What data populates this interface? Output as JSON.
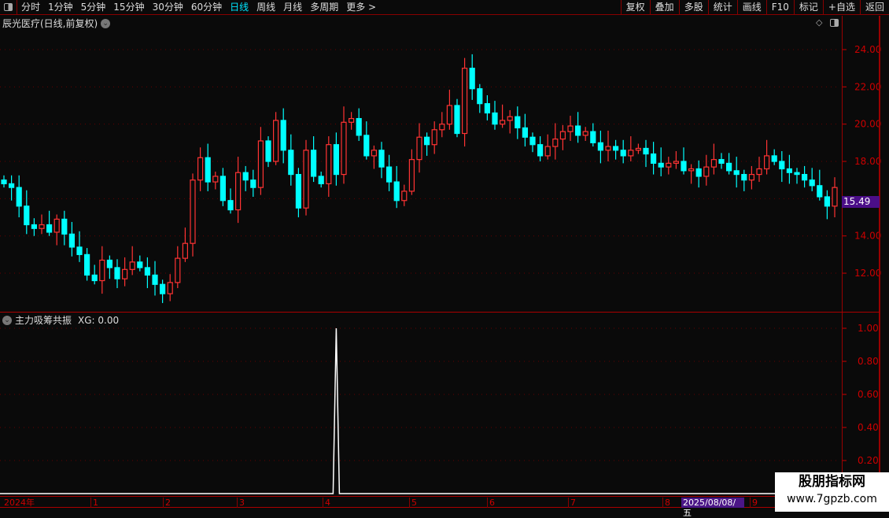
{
  "toolbar": {
    "periods": [
      "分时",
      "1分钟",
      "5分钟",
      "15分钟",
      "30分钟",
      "60分钟",
      "日线",
      "周线",
      "月线",
      "多周期",
      "更多 >"
    ],
    "active_period": "日线",
    "actions": [
      "复权",
      "叠加",
      "多股",
      "统计",
      "画线",
      "F10",
      "标记",
      "+自选",
      "返回"
    ]
  },
  "chart": {
    "title": "辰光医疗(日线,前复权)",
    "current_price_label": "15.49",
    "colors": {
      "up": "#ff3333",
      "down": "#00ffff",
      "axis": "#cc0000",
      "grid": "#660000"
    }
  },
  "indicator": {
    "name": "主力吸筹共振",
    "value_label": "XG: 0.00"
  },
  "time_axis": {
    "labels": [
      "2024年",
      "1",
      "2",
      "3",
      "4",
      "5",
      "6",
      "7",
      "8",
      "9"
    ],
    "cursor_date": "2025/08/08/五"
  },
  "watermark": {
    "line1": "股朋指标网",
    "line2": "www.7gpzb.com"
  },
  "chart_data": {
    "type": "candlestick",
    "y_ticks": [
      "24.00",
      "22.00",
      "20.00",
      "18.00",
      "14.00",
      "12.00"
    ],
    "ylim": [
      10.5,
      25
    ],
    "close": [
      16.8,
      16.6,
      15.6,
      14.6,
      14.4,
      14.6,
      14.2,
      14.9,
      14.1,
      13.4,
      13.0,
      11.9,
      11.6,
      12.7,
      12.3,
      11.7,
      12.2,
      12.6,
      12.3,
      11.9,
      11.4,
      10.9,
      11.5,
      12.8,
      13.6,
      17.0,
      18.2,
      16.9,
      17.2,
      15.9,
      15.4,
      17.4,
      17.0,
      16.6,
      19.1,
      18.0,
      20.2,
      18.6,
      17.3,
      15.5,
      18.6,
      17.2,
      16.8,
      18.9,
      17.3,
      20.1,
      20.3,
      19.4,
      18.3,
      18.6,
      17.7,
      16.9,
      15.9,
      16.4,
      18.1,
      19.3,
      18.9,
      19.7,
      20.0,
      21.0,
      19.5,
      23.0,
      21.9,
      21.1,
      20.6,
      20.0,
      20.2,
      20.4,
      19.8,
      19.3,
      18.9,
      18.3,
      18.8,
      19.2,
      19.6,
      19.9,
      19.4,
      19.6,
      19.0,
      18.6,
      18.8,
      18.6,
      18.3,
      18.6,
      18.7,
      18.4,
      17.9,
      17.7,
      17.9,
      18.0,
      17.5,
      17.6,
      17.2,
      17.7,
      18.1,
      17.9,
      17.5,
      17.3,
      17.0,
      17.3,
      17.6,
      18.3,
      18.0,
      17.6,
      17.4,
      17.3,
      17.0,
      16.7,
      16.1,
      15.6,
      16.6
    ],
    "indicator_ticks": [
      "1.00",
      "0.80",
      "0.60",
      "0.40",
      "0.20"
    ],
    "indicator_ylim": [
      0,
      1
    ],
    "indicator_signal_index": 44,
    "indicator_signal_value": 1.0
  }
}
